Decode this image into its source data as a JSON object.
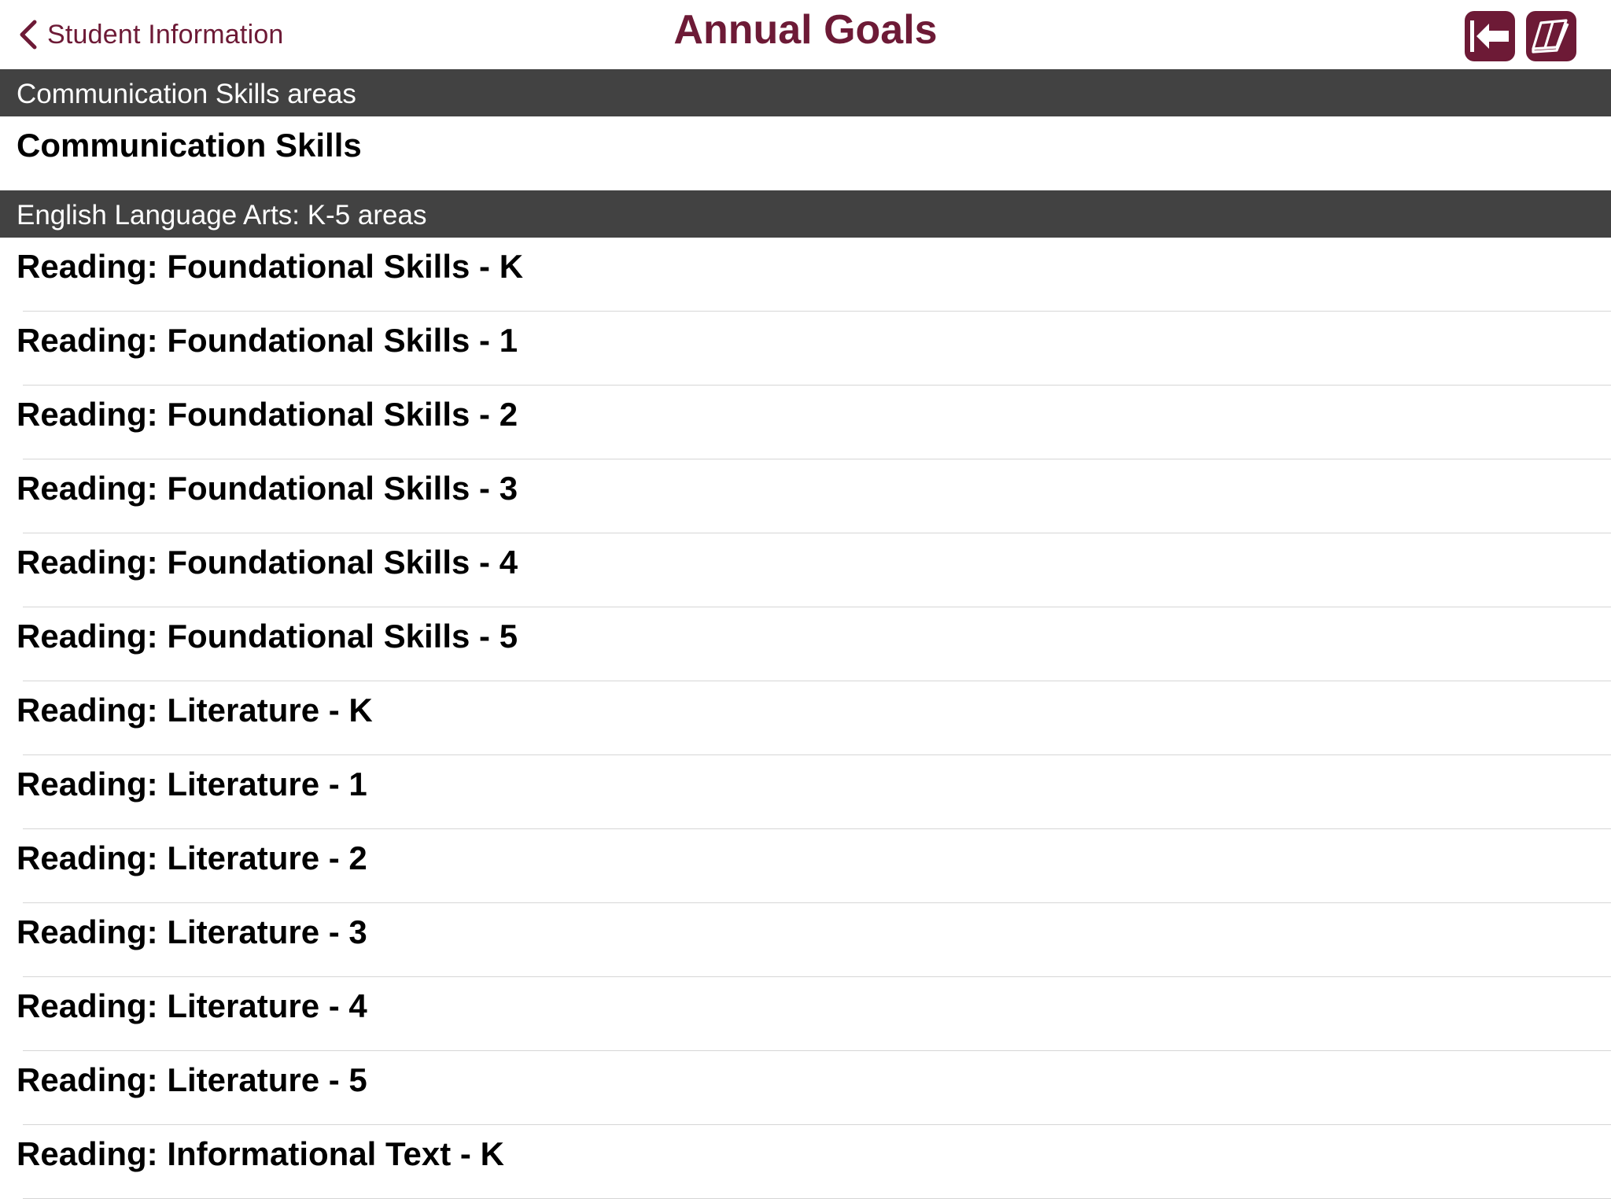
{
  "nav": {
    "back_label": "Student Information",
    "title": "Annual Goals",
    "accent_color": "#6d1a36",
    "actions": [
      {
        "icon": "exit-arrow-icon"
      },
      {
        "icon": "open-book-icon"
      }
    ]
  },
  "sections": [
    {
      "header": "Communication Skills areas",
      "items": [
        {
          "label": "Communication Skills"
        }
      ]
    },
    {
      "header": "English Language Arts: K-5 areas",
      "items": [
        {
          "label": "Reading: Foundational Skills - K"
        },
        {
          "label": "Reading: Foundational Skills - 1"
        },
        {
          "label": "Reading: Foundational Skills - 2"
        },
        {
          "label": "Reading: Foundational Skills - 3"
        },
        {
          "label": "Reading: Foundational Skills - 4"
        },
        {
          "label": "Reading: Foundational Skills - 5"
        },
        {
          "label": "Reading: Literature - K"
        },
        {
          "label": "Reading: Literature - 1"
        },
        {
          "label": "Reading: Literature - 2"
        },
        {
          "label": "Reading: Literature - 3"
        },
        {
          "label": "Reading: Literature - 4"
        },
        {
          "label": "Reading: Literature - 5"
        },
        {
          "label": "Reading: Informational Text - K"
        }
      ]
    }
  ],
  "colors": {
    "section_header_bg": "#424242",
    "separator": "#d6d6d6"
  }
}
